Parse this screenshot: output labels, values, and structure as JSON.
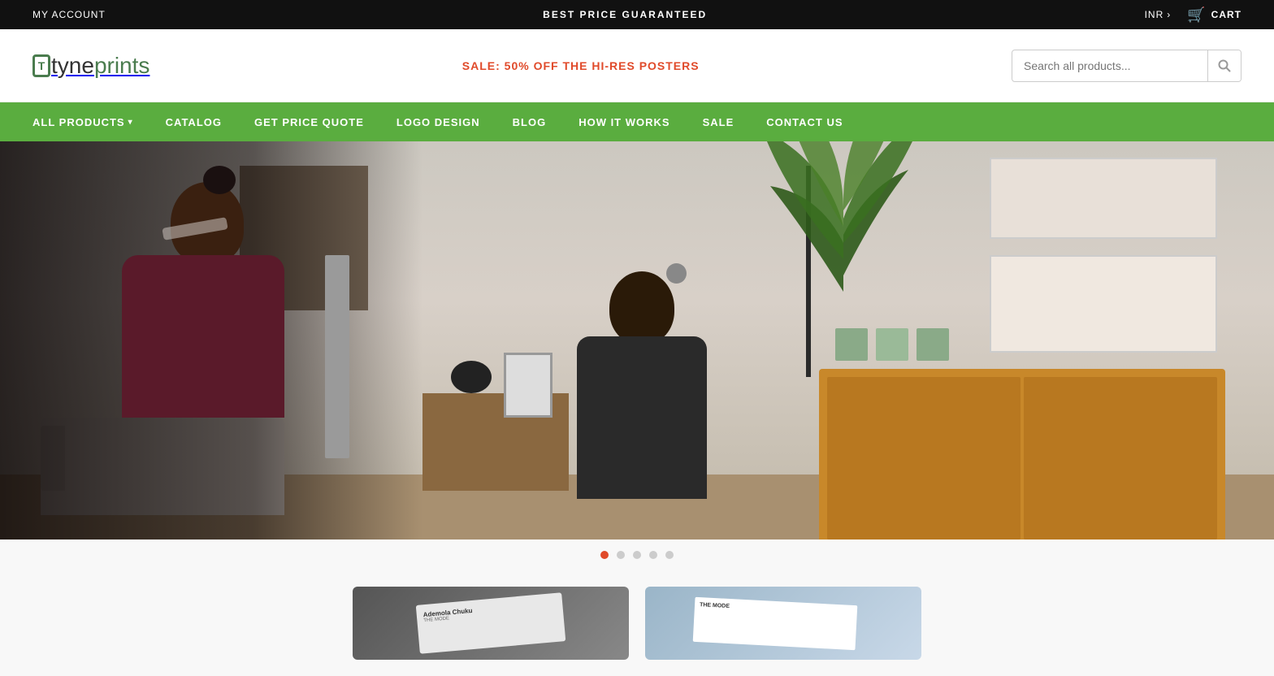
{
  "topbar": {
    "account_label": "MY ACCOUNT",
    "best_price_label": "BEST PRICE GUARANTEED",
    "currency_label": "INR",
    "cart_label": "CART"
  },
  "header": {
    "logo_text_pre": "tyne",
    "logo_text_post": "prints",
    "sale_text": "SALE: 50% OFF THE HI-RES POSTERS",
    "search_placeholder": "Search all products..."
  },
  "nav": {
    "items": [
      {
        "label": "ALL PRODUCTS",
        "has_dropdown": true
      },
      {
        "label": "CATALOG",
        "has_dropdown": false
      },
      {
        "label": "GET PRICE QUOTE",
        "has_dropdown": false
      },
      {
        "label": "LOGO DESIGN",
        "has_dropdown": false
      },
      {
        "label": "BLOG",
        "has_dropdown": false
      },
      {
        "label": "HOW IT WORKS",
        "has_dropdown": false
      },
      {
        "label": "SALE",
        "has_dropdown": false
      },
      {
        "label": "CONTACT US",
        "has_dropdown": false
      }
    ]
  },
  "carousel": {
    "total_dots": 5,
    "active_dot": 0
  },
  "products": [
    {
      "id": 1,
      "bg": "#666"
    },
    {
      "id": 2,
      "bg": "#9ab5c8"
    }
  ]
}
